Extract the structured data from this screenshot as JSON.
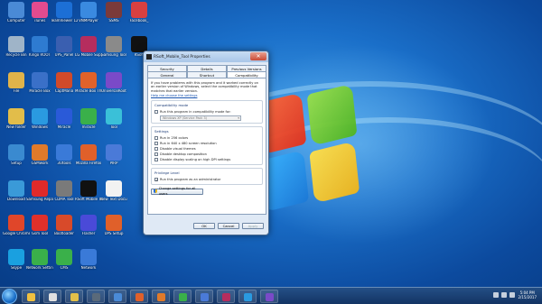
{
  "desktop": {
    "icons": [
      {
        "label": "Computer",
        "color": "#4a8ad6"
      },
      {
        "label": "iTunes",
        "color": "#e24b8f"
      },
      {
        "label": "TeamViewer 12",
        "color": "#1c6fd6"
      },
      {
        "label": "VNMPlayer",
        "color": "#3a8ae0"
      },
      {
        "label": "SSMS",
        "color": "#7a3a3a"
      },
      {
        "label": "Facebook_",
        "color": "#d84040"
      },
      {
        "label": "Recycle Bin",
        "color": "#9fb4c8"
      },
      {
        "label": "Kingo ROOT",
        "color": "#2e7bd1"
      },
      {
        "label": "UPS_Panel",
        "color": "#3a5fb0"
      },
      {
        "label": "LG Mobile Support Tool",
        "color": "#b52d5e"
      },
      {
        "label": "Samsung Tool",
        "color": "#8a8a8a"
      },
      {
        "label": "RSoft",
        "color": "#111111"
      },
      {
        "label": "File",
        "color": "#e0b34a"
      },
      {
        "label": "Miracle Box",
        "color": "#3a70c8"
      },
      {
        "label": "CaptMana",
        "color": "#d14a2a"
      },
      {
        "label": "Miracle Box Thunder",
        "color": "#e0622a"
      },
      {
        "label": "UniversalRoot",
        "color": "#7a4ac8"
      },
      {
        "label": "New folder",
        "color": "#e2bd4a"
      },
      {
        "label": "Windows",
        "color": "#2a9ae0"
      },
      {
        "label": "Miracle",
        "color": "#2a5ad8"
      },
      {
        "label": "miracle",
        "color": "#3ab04a"
      },
      {
        "label": "Tool",
        "color": "#3ac0d8"
      },
      {
        "label": "Setup",
        "color": "#3a8ad0"
      },
      {
        "label": "GSMwork",
        "color": "#e07a2a"
      },
      {
        "label": "3Utools",
        "color": "#3a7ad8"
      },
      {
        "label": "Mozilla Firefox",
        "color": "#e0602a"
      },
      {
        "label": "PIRP",
        "color": "#4a7ad8"
      },
      {
        "label": "Download",
        "color": "#3a9ad8"
      },
      {
        "label": "Samsung Repair",
        "color": "#e02a2a"
      },
      {
        "label": "CDMA Tool",
        "color": "#7a7a7a"
      },
      {
        "label": "RSoft Mobile Tool",
        "color": "#111111"
      },
      {
        "label": "New Text Document",
        "color": "#f2f2f2"
      },
      {
        "label": "Google Chrome",
        "color": "#e0462a"
      },
      {
        "label": "Gsm Tool",
        "color": "#e0302a"
      },
      {
        "label": "Bootloader",
        "color": "#d84a2a"
      },
      {
        "label": "Flasher",
        "color": "#4a4ad8"
      },
      {
        "label": "UPS Setup",
        "color": "#e0602a"
      },
      {
        "label": "Skype",
        "color": "#1aa0e0"
      },
      {
        "label": "Network Settings",
        "color": "#3ab04a"
      },
      {
        "label": "CMS",
        "color": "#3ab04a"
      },
      {
        "label": "Network",
        "color": "#3a7ad8"
      }
    ]
  },
  "dialog": {
    "title": "RSoft_Mobile_Tool Properties",
    "close_glyph": "✕",
    "tabs_row1": [
      "Security",
      "Details",
      "Previous Versions"
    ],
    "tabs_row2": [
      "General",
      "Shortcut",
      "Compatibility"
    ],
    "intro_text": "If you have problems with this program and it worked correctly on an earlier version of Windows, select the compatibility mode that matches that earlier version.",
    "help_link": "Help me choose the settings",
    "compat_group": {
      "title": "Compatibility mode",
      "checkbox": "Run this program in compatibility mode for:",
      "select_value": "Windows XP (Service Pack 3)"
    },
    "settings_group": {
      "title": "Settings",
      "options": [
        "Run in 256 colors",
        "Run in 640 x 480 screen resolution",
        "Disable visual themes",
        "Disable desktop composition",
        "Disable display scaling on high DPI settings"
      ]
    },
    "privilege_group": {
      "title": "Privilege Level",
      "option": "Run this program as an administrator",
      "checked_glyph": "✓"
    },
    "change_all_users": "Change settings for all users",
    "buttons": {
      "ok": "OK",
      "cancel": "Cancel",
      "apply": "Apply"
    }
  },
  "taskbar": {
    "pinned": [
      {
        "color": "#f0c040"
      },
      {
        "color": "#e0e0e0"
      },
      {
        "color": "#e2c04a"
      },
      {
        "color": "#5a6a7a"
      },
      {
        "color": "#4a8ad6"
      },
      {
        "color": "#e0602a"
      },
      {
        "color": "#e07a2a"
      },
      {
        "color": "#3ab04a"
      },
      {
        "color": "#4a7ad8"
      },
      {
        "color": "#b52d5e"
      },
      {
        "color": "#2a9ae0"
      },
      {
        "color": "#7a4ac8"
      }
    ],
    "clock_time": "5:04 PM",
    "clock_date": "2/15/2017"
  }
}
